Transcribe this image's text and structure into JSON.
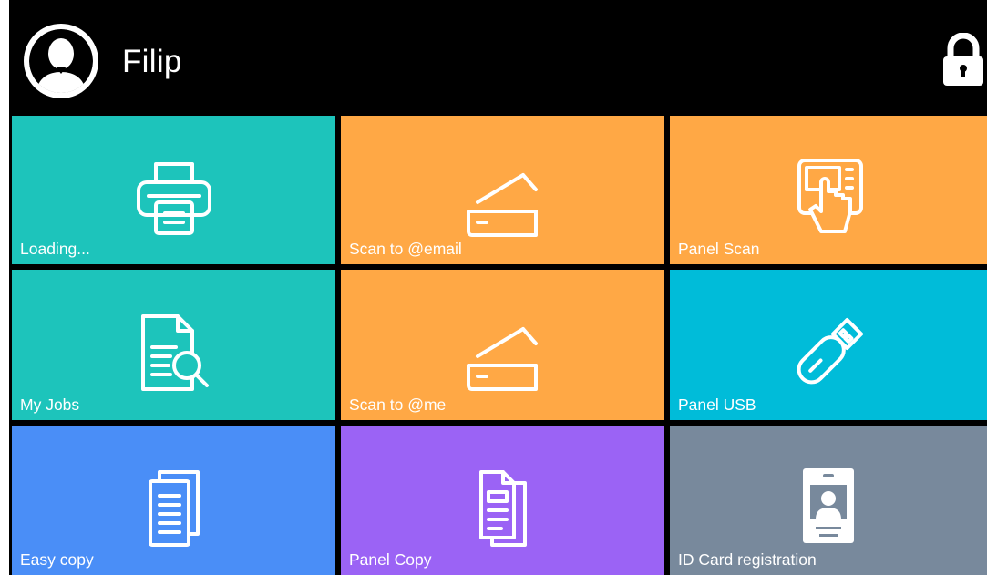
{
  "header": {
    "user_name": "Filip",
    "avatar_icon": "user-avatar-icon",
    "lock_icon": "lock-icon"
  },
  "tiles": [
    {
      "label": "Loading...",
      "icon": "printer-icon",
      "color": "#1dc4bb"
    },
    {
      "label": "Scan to @email",
      "icon": "scanner-icon",
      "color": "#ffa845"
    },
    {
      "label": "Panel Scan",
      "icon": "touch-panel-icon",
      "color": "#ffa845"
    },
    {
      "label": "My Jobs",
      "icon": "document-search-icon",
      "color": "#1dc4bb"
    },
    {
      "label": "Scan to @me",
      "icon": "scanner-icon",
      "color": "#ffa845"
    },
    {
      "label": "Panel USB",
      "icon": "usb-drive-icon",
      "color": "#00bcd9"
    },
    {
      "label": "Easy copy",
      "icon": "copy-documents-icon",
      "color": "#4a8ef7"
    },
    {
      "label": "Panel Copy",
      "icon": "copy-document-icon",
      "color": "#9b63f5"
    },
    {
      "label": "ID Card registration",
      "icon": "id-card-icon",
      "color": "#78899c"
    }
  ]
}
